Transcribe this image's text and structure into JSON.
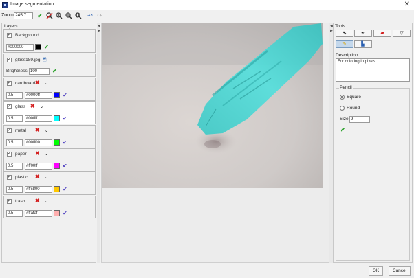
{
  "window": {
    "title": "Image segmentation",
    "close_icon": "close-icon"
  },
  "toolbar": {
    "zoom_label": "Zoom",
    "zoom_value": "245.7",
    "icons": [
      "apply-check-icon",
      "zoom-reset-icon",
      "zoom-in-icon",
      "zoom-out-icon",
      "zoom-fit-icon",
      "undo-icon",
      "redo-icon"
    ]
  },
  "layers": {
    "title": "Layers",
    "background": {
      "label": "Background",
      "color": "#000000",
      "color_swatch": "#000000"
    },
    "image": {
      "label": "glass189.jpg",
      "brightness_label": "Brightness",
      "brightness": "100"
    },
    "items": [
      {
        "label": "cardboard",
        "opacity": "0.5",
        "color": "#0000ff",
        "swatch": "#0000ff"
      },
      {
        "label": "glass",
        "opacity": "0.5",
        "color": "#00ffff",
        "swatch": "#00ffff"
      },
      {
        "label": "metal",
        "opacity": "0.5",
        "color": "#00ff00",
        "swatch": "#00ff00"
      },
      {
        "label": "paper",
        "opacity": "0.5",
        "color": "#ff00ff",
        "swatch": "#ff00ff"
      },
      {
        "label": "plastic",
        "opacity": "0.5",
        "color": "#ffc800",
        "swatch": "#ffc800"
      },
      {
        "label": "trash",
        "opacity": "0.5",
        "color": "#ffafaf",
        "swatch": "#ffafaf"
      }
    ]
  },
  "tools": {
    "title": "Tools",
    "description_title": "Description",
    "description_text": "For coloring in pixels.",
    "pencil_title": "Pencil",
    "square_label": "Square",
    "round_label": "Round",
    "size_label": "Size",
    "size_value": "9"
  },
  "buttons": {
    "ok": "OK",
    "cancel": "Cancel"
  }
}
